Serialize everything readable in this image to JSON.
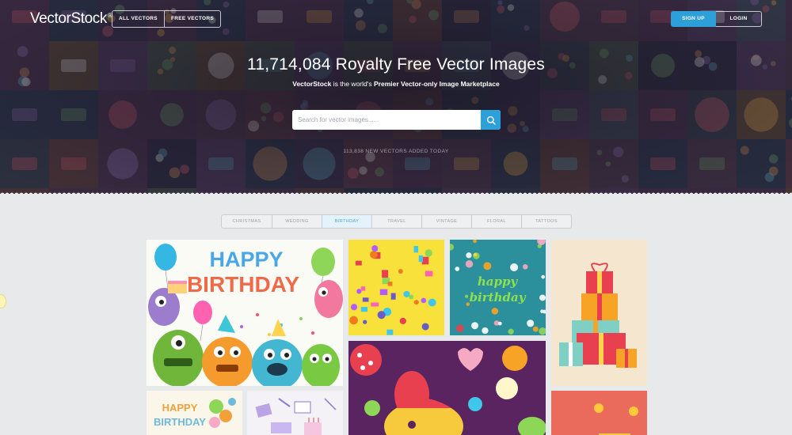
{
  "brand": {
    "name": "VectorStock",
    "reg": "®"
  },
  "header": {
    "nav": [
      "ALL VECTORS",
      "FREE VECTORS"
    ],
    "signup": "SIGN UP",
    "login": "LOGIN"
  },
  "hero": {
    "headline": "11,714,084 Royalty Free Vector Images",
    "sub_brand": "VectorStock",
    "sub_middle": " is the world's ",
    "sub_bold": "Premier Vector-only Image Marketplace",
    "search_placeholder": "Search for vector images......",
    "added": "113,838 NEW VECTORS ADDED TODAY"
  },
  "categories": {
    "tabs": [
      "CHRISTMAS",
      "WEDDING",
      "BIRTHDAY",
      "TRAVEL",
      "VINTAGE",
      "FLORAL",
      "TATTOOS"
    ],
    "active": "BIRTHDAY"
  },
  "artwork": {
    "happy_birthday_big": [
      "HAPPY",
      "BIRTHDAY"
    ],
    "happy_birthday_green": [
      "happy",
      "birthday"
    ],
    "happy_birthday_small": [
      "HAPPY",
      "BIRTHDAY"
    ]
  },
  "colors": {
    "accent": "#2d9fd9",
    "page_bg": "#e7e9ea",
    "hero_bg": "#2a2435"
  }
}
